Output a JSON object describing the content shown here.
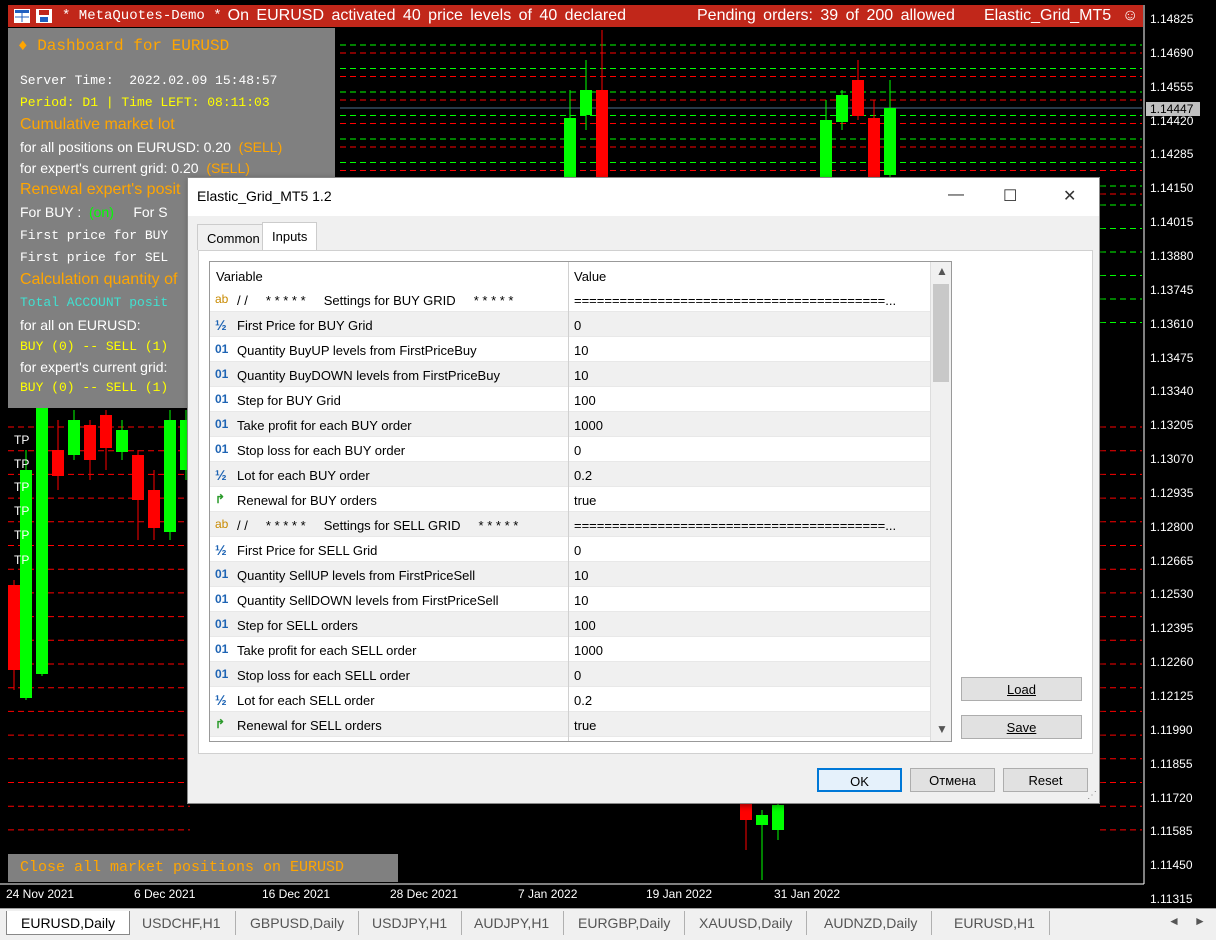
{
  "status_bar": {
    "account": "* MetaQuotes-Demo *",
    "activation_msg": "On  EURUSD  activated  40  price levels of  40  declared",
    "pending_msg": "Pending orders:  39  of  200  allowed",
    "ea_name": "Elastic_Grid_MT5",
    "smile": "☺"
  },
  "dashboard": {
    "title": "♦  Dashboard for EURUSD",
    "server_time_label": "Server Time:",
    "server_time": "2022.02.09 15:48:57",
    "period_line": "Period: D1 | Time LEFT: 08:11:03",
    "cumulative_label": "Cumulative market lot",
    "all_positions_label": "for  all  positions  on  EURUSD:  0.20",
    "all_positions_dir": "(SELL)",
    "expert_grid_label": "for  expert's  current  grid:  0.20",
    "expert_grid_dir": "(SELL)",
    "renewal_label": "Renewal  expert's  posit",
    "for_buy_label": "For BUY :",
    "for_buy_status": "(on)",
    "for_sell_label": "For S",
    "first_price_buy": "First price for BUY",
    "first_price_sell": "First price for SEL",
    "calc_quantity": "Calculation quantity of",
    "total_account": "Total ACCOUNT posit",
    "for_all_eurusd": "for  all  on  EURUSD:",
    "buy_sell_1": "BUY (0) -- SELL (1)",
    "for_expert_grid": "for  expert's  current  grid:",
    "buy_sell_2": "BUY (0) -- SELL (1)",
    "close_all": "Close all market positions on EURUSD"
  },
  "tp_labels": [
    "TP",
    "TP",
    "TP",
    "TP",
    "TP",
    "TP"
  ],
  "price_axis": [
    "1.14825",
    "1.14690",
    "1.14555",
    "1.14420",
    "1.14285",
    "1.14150",
    "1.14015",
    "1.13880",
    "1.13745",
    "1.13610",
    "1.13475",
    "1.13340",
    "1.13205",
    "1.13070",
    "1.12935",
    "1.12800",
    "1.12665",
    "1.12530",
    "1.12395",
    "1.12260",
    "1.12125",
    "1.11990",
    "1.11855",
    "1.11720",
    "1.11585",
    "1.11450",
    "1.11315"
  ],
  "current_price": "1.14447",
  "date_axis": [
    "24 Nov 2021",
    "6 Dec 2021",
    "16 Dec 2021",
    "28 Dec 2021",
    "7 Jan 2022",
    "19 Jan 2022",
    "31 Jan 2022"
  ],
  "tabs": [
    "EURUSD,Daily",
    "USDCHF,H1",
    "GBPUSD,Daily",
    "USDJPY,H1",
    "AUDJPY,H1",
    "EURGBP,Daily",
    "XAUUSD,Daily",
    "AUDNZD,Daily",
    "EURUSD,H1"
  ],
  "tab_arrows": [
    "◄",
    "►"
  ],
  "dialog": {
    "title": "Elastic_Grid_MT5 1.2",
    "window_buttons": [
      "—",
      "☐",
      "✕"
    ],
    "tab_common": "Common",
    "tab_inputs": "Inputs",
    "col_variable": "Variable",
    "col_value": "Value",
    "rows": [
      {
        "icon": "ab",
        "var": "/ /     * * * * *     Settings for BUY GRID     * * * * *",
        "val": "=========================================..."
      },
      {
        "icon": "½",
        "var": "First Price for BUY Grid",
        "val": "0"
      },
      {
        "icon": "01",
        "var": "Quantity BuyUP levels from FirstPriceBuy",
        "val": "10"
      },
      {
        "icon": "01",
        "var": "Quantity BuyDOWN levels from FirstPriceBuy",
        "val": "10"
      },
      {
        "icon": "01",
        "var": "Step for BUY Grid",
        "val": "100"
      },
      {
        "icon": "01",
        "var": "Take profit for each BUY order",
        "val": "1000"
      },
      {
        "icon": "01",
        "var": "Stop loss for each BUY order",
        "val": "0"
      },
      {
        "icon": "½",
        "var": "Lot for each BUY order",
        "val": "0.2"
      },
      {
        "icon": "↱",
        "var": "Renewal for BUY orders",
        "val": "true"
      },
      {
        "icon": "ab",
        "var": "/ /     * * * * *     Settings for SELL GRID     * * * * *",
        "val": "=========================================..."
      },
      {
        "icon": "½",
        "var": "First Price for SELL Grid",
        "val": "0"
      },
      {
        "icon": "01",
        "var": "Quantity SellUP levels from FirstPriceSell",
        "val": "10"
      },
      {
        "icon": "01",
        "var": "Quantity SellDOWN levels from FirstPriceSell",
        "val": "10"
      },
      {
        "icon": "01",
        "var": "Step for SELL orders",
        "val": "100"
      },
      {
        "icon": "01",
        "var": "Take profit for each SELL order",
        "val": "1000"
      },
      {
        "icon": "01",
        "var": "Stop loss for each SELL order",
        "val": "0"
      },
      {
        "icon": "½",
        "var": "Lot for each SELL order",
        "val": "0.2"
      },
      {
        "icon": "↱",
        "var": "Renewal for SELL orders",
        "val": "true"
      }
    ],
    "btn_load": "Load",
    "btn_save": "Save",
    "btn_ok": "OK",
    "btn_cancel": "Отмена",
    "btn_reset": "Reset",
    "scroll_up": "▲",
    "scroll_down": "▼",
    "grip": "⋰"
  },
  "colors": {
    "status_bar": "#c1271a",
    "bull_candle": "#00ff00",
    "bear_candle": "#ff0000",
    "dashboard_bg": "#808080",
    "grid_green": "#00ff00",
    "grid_red": "#ff0000"
  }
}
